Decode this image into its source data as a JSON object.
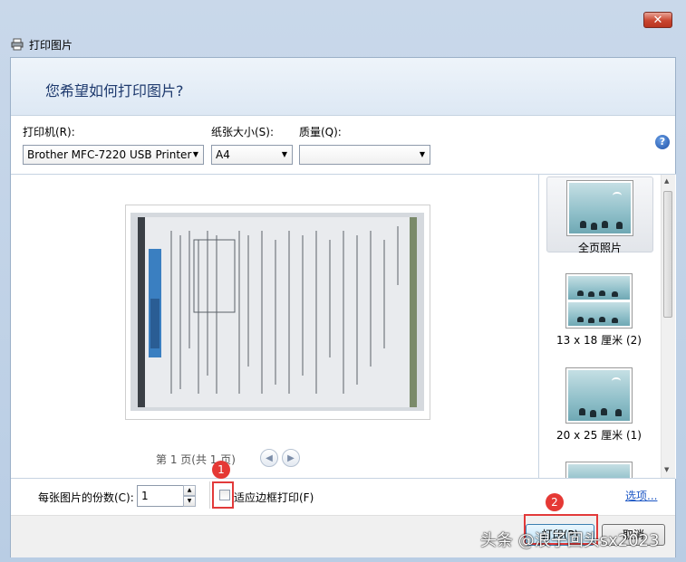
{
  "window": {
    "title": "打印图片",
    "close_glyph": "✕"
  },
  "header": {
    "question": "您希望如何打印图片?"
  },
  "options": {
    "printer_label": "打印机(R):",
    "printer_value": "Brother MFC-7220 USB Printer",
    "paper_label": "纸张大小(S):",
    "paper_value": "A4",
    "quality_label": "质量(Q):",
    "quality_value": "",
    "help_glyph": "?"
  },
  "preview": {
    "page_info": "第 1 页(共 1 页)",
    "prev_glyph": "◀",
    "next_glyph": "▶"
  },
  "layouts": [
    {
      "label": "全页照片",
      "selected": true
    },
    {
      "label": "13 x 18 厘米 (2)",
      "selected": false
    },
    {
      "label": "20 x 25 厘米 (1)",
      "selected": false
    },
    {
      "label": "",
      "selected": false
    }
  ],
  "bottom": {
    "copies_label": "每张图片的份数(C):",
    "copies_value": "1",
    "fit_label": "适应边框打印(F)",
    "fit_checked": false,
    "options_link": "选项..."
  },
  "footer": {
    "print_label": "打印(P)",
    "cancel_label": "取消"
  },
  "annotations": {
    "badge1": "1",
    "badge2": "2",
    "highlight_color": "#e23a3a"
  },
  "watermark": "头条 @浪子回头sx2023"
}
